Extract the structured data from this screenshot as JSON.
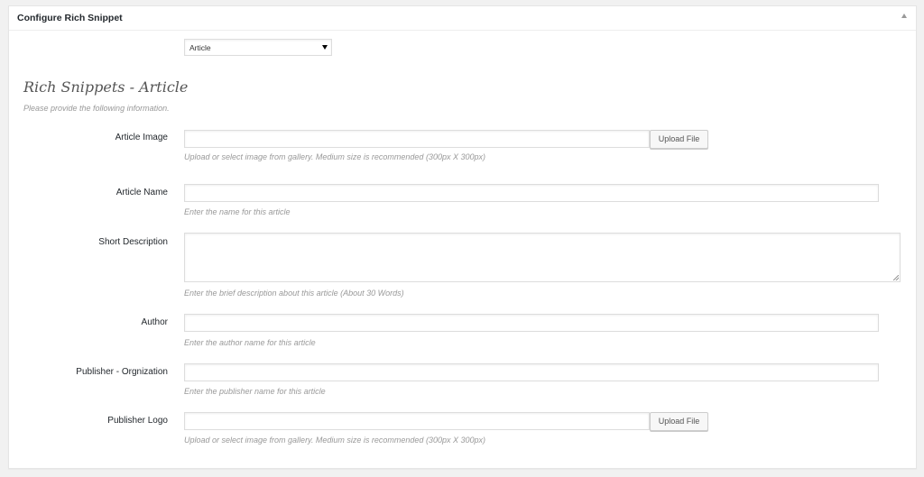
{
  "metabox": {
    "title": "Configure Rich Snippet"
  },
  "type_select": {
    "value": "Article"
  },
  "section": {
    "heading": "Rich Snippets - Article",
    "description": "Please provide the following information."
  },
  "fields": {
    "article_image": {
      "label": "Article Image",
      "value": "",
      "button_label": "Upload File",
      "help": "Upload or select image from gallery. Medium size is recommended (300px X 300px)"
    },
    "article_name": {
      "label": "Article Name",
      "value": "",
      "help": "Enter the name for this article"
    },
    "short_description": {
      "label": "Short Description",
      "value": "",
      "help": "Enter the brief description about this article (About 30 Words)"
    },
    "author": {
      "label": "Author",
      "value": "",
      "help": "Enter the author name for this article"
    },
    "publisher_organization": {
      "label": "Publisher - Orgnization",
      "value": "",
      "help": "Enter the publisher name for this article"
    },
    "publisher_logo": {
      "label": "Publisher Logo",
      "value": "",
      "button_label": "Upload File",
      "help": "Upload or select image from gallery. Medium size is recommended (300px X 300px)"
    }
  },
  "colors": {
    "page_background": "#f1f1f1",
    "panel_background": "#ffffff",
    "help_text": "#999999",
    "label_text": "#23282d"
  },
  "icons": {
    "collapse_toggle": "triangle-up-icon",
    "select_arrow": "caret-down-icon",
    "textarea_resize": "resize-grip-icon"
  }
}
